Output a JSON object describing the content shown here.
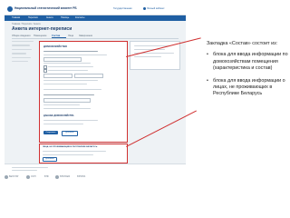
{
  "header": {
    "site_title": "Национальный статистический комитет РБ",
    "link_1": "Государственная",
    "link_2": "Личный кабинет"
  },
  "nav": {
    "items": [
      "Главная",
      "Переписи",
      "Анкета",
      "Помощь",
      "Контакты"
    ]
  },
  "breadcrumb": "Главная / Переписи / Анкета",
  "page_title": "Анкета интернет-переписи",
  "tabs": [
    "Общие сведения",
    "Помещение",
    "Состав",
    "Лица",
    "Завершение"
  ],
  "panel_main": {
    "title": "ДОМОХОЗЯЙСТВО",
    "subtitle": "ДАННЫЕ ДОМОХОЗЯЙСТВА",
    "button_save": "Сохранить",
    "button_add": "Добавить"
  },
  "panel_persons": {
    "title": "ЛИЦА, НЕ ПРОЖИВАЮЩИЕ В РЕСПУБЛИКЕ БЕЛАРУСЬ",
    "button": "Добавить"
  },
  "footer_logos": [
    "БЕЛСТАТ",
    "ООН",
    "БТФ",
    "ЮНИСЕФ",
    "ЮНФПА"
  ],
  "annotation": {
    "title": "Закладка «Состав» состоит из:",
    "items": [
      "блока для ввода информации по домохозяйствам помещения (характеристика и состав)",
      "блока для ввода информации о лицах, не проживающих в Республике Беларусь"
    ]
  },
  "colors": {
    "accent": "#1f5fa3",
    "highlight": "#d03030"
  }
}
